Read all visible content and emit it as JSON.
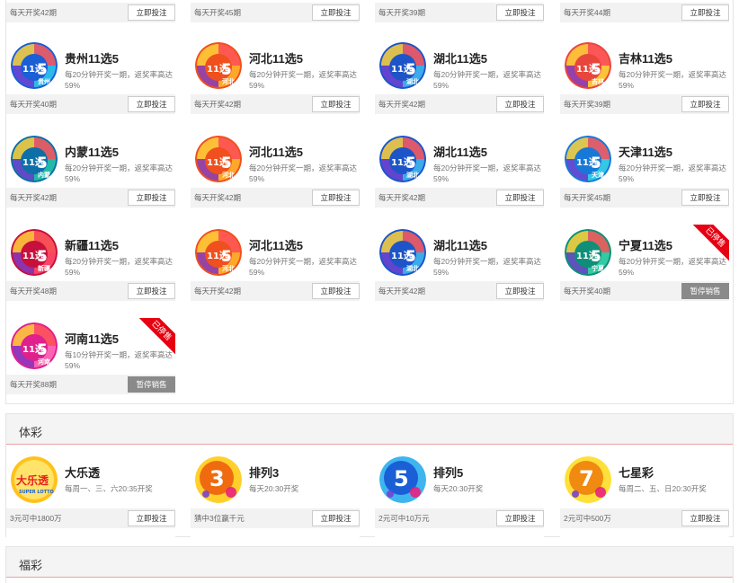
{
  "top_row": [
    {
      "info": "每天开奖42期",
      "button": "立即投注"
    },
    {
      "info": "每天开奖45期",
      "button": "立即投注"
    },
    {
      "info": "每天开奖39期",
      "button": "立即投注"
    },
    {
      "info": "每天开奖44期",
      "button": "立即投注"
    }
  ],
  "games_11x5": [
    {
      "name": "贵州11选5",
      "desc": "每20分钟开奖一期，返奖率高达59%",
      "info": "每天开奖40期",
      "button": "立即投注",
      "stopped": false,
      "province": "贵州",
      "colors": [
        "#1a5fd6",
        "#2fc3ee"
      ]
    },
    {
      "name": "河北11选5",
      "desc": "每20分钟开奖一期，返奖率高达59%",
      "info": "每天开奖42期",
      "button": "立即投注",
      "stopped": false,
      "province": "河北",
      "colors": [
        "#f0501e",
        "#ffb12a"
      ]
    },
    {
      "name": "湖北11选5",
      "desc": "每20分钟开奖一期，返奖率高达59%",
      "info": "每天开奖42期",
      "button": "立即投注",
      "stopped": false,
      "province": "湖北",
      "colors": [
        "#1d55c8",
        "#3fb5f0"
      ]
    },
    {
      "name": "吉林11选5",
      "desc": "每20分钟开奖一期，返奖率高达59%",
      "info": "每天开奖39期",
      "button": "立即投注",
      "stopped": false,
      "province": "吉林",
      "colors": [
        "#e8463c",
        "#ffd23a"
      ]
    },
    {
      "name": "内蒙11选5",
      "desc": "每20分钟开奖一期，返奖率高达59%",
      "info": "每天开奖42期",
      "button": "立即投注",
      "stopped": false,
      "province": "内蒙",
      "colors": [
        "#0e6fa8",
        "#22c2a6"
      ]
    },
    {
      "name": "河北11选5",
      "desc": "每20分钟开奖一期，返奖率高达59%",
      "info": "每天开奖42期",
      "button": "立即投注",
      "stopped": false,
      "province": "河北",
      "colors": [
        "#f0501e",
        "#ffb12a"
      ]
    },
    {
      "name": "湖北11选5",
      "desc": "每20分钟开奖一期，返奖率高达59%",
      "info": "每天开奖42期",
      "button": "立即投注",
      "stopped": false,
      "province": "湖北",
      "colors": [
        "#1d55c8",
        "#3fb5f0"
      ]
    },
    {
      "name": "天津11选5",
      "desc": "每20分钟开奖一期，返奖率高达59%",
      "info": "每天开奖45期",
      "button": "立即投注",
      "stopped": false,
      "province": "天津",
      "colors": [
        "#1878d8",
        "#35d0e8"
      ]
    },
    {
      "name": "新疆11选5",
      "desc": "每20分钟开奖一期，返奖率高达59%",
      "info": "每天开奖48期",
      "button": "立即投注",
      "stopped": false,
      "province": "新疆",
      "colors": [
        "#c8103c",
        "#ff4a6a"
      ]
    },
    {
      "name": "河北11选5",
      "desc": "每20分钟开奖一期，返奖率高达59%",
      "info": "每天开奖42期",
      "button": "立即投注",
      "stopped": false,
      "province": "河北",
      "colors": [
        "#f0501e",
        "#ffb12a"
      ]
    },
    {
      "name": "湖北11选5",
      "desc": "每20分钟开奖一期，返奖率高达59%",
      "info": "每天开奖42期",
      "button": "立即投注",
      "stopped": false,
      "province": "湖北",
      "colors": [
        "#1d55c8",
        "#3fb5f0"
      ]
    },
    {
      "name": "宁夏11选5",
      "desc": "每20分钟开奖一期，返奖率高达59%",
      "info": "每天开奖40期",
      "button": "暂停销售",
      "stopped": true,
      "ribbon": "已停售",
      "province": "宁夏",
      "colors": [
        "#0f8f7a",
        "#38d0a8"
      ]
    },
    {
      "name": "河南11选5",
      "desc": "每10分钟开奖一期，返奖率高达59%",
      "info": "每天开奖88期",
      "button": "暂停销售",
      "stopped": true,
      "ribbon": "已停售",
      "province": "河南",
      "colors": [
        "#e0208c",
        "#ff6ab8"
      ]
    }
  ],
  "ticai": {
    "title": "体彩",
    "games": [
      {
        "name": "大乐透",
        "desc": "每周一、三、六20:35开奖",
        "info": "3元可中1800万",
        "button": "立即投注",
        "logo_text": "大乐透",
        "logo_sub": "SUPER LOTTO",
        "colors": [
          "#e82020",
          "#ffc21a"
        ]
      },
      {
        "name": "排列3",
        "desc": "每天20:30开奖",
        "info": "猜中3位赢千元",
        "button": "立即投注",
        "logo_text": "3",
        "colors": [
          "#f06a10",
          "#ffd02a"
        ]
      },
      {
        "name": "排列5",
        "desc": "每天20:30开奖",
        "info": "2元可中10万元",
        "button": "立即投注",
        "logo_text": "5",
        "colors": [
          "#1a5fd6",
          "#3fb5f0"
        ]
      },
      {
        "name": "七星彩",
        "desc": "每周二、五、日20:30开奖",
        "info": "2元可中500万",
        "button": "立即投注",
        "logo_text": "7",
        "colors": [
          "#f08a10",
          "#ffe03a"
        ]
      }
    ]
  },
  "fucai": {
    "title": "福彩"
  }
}
